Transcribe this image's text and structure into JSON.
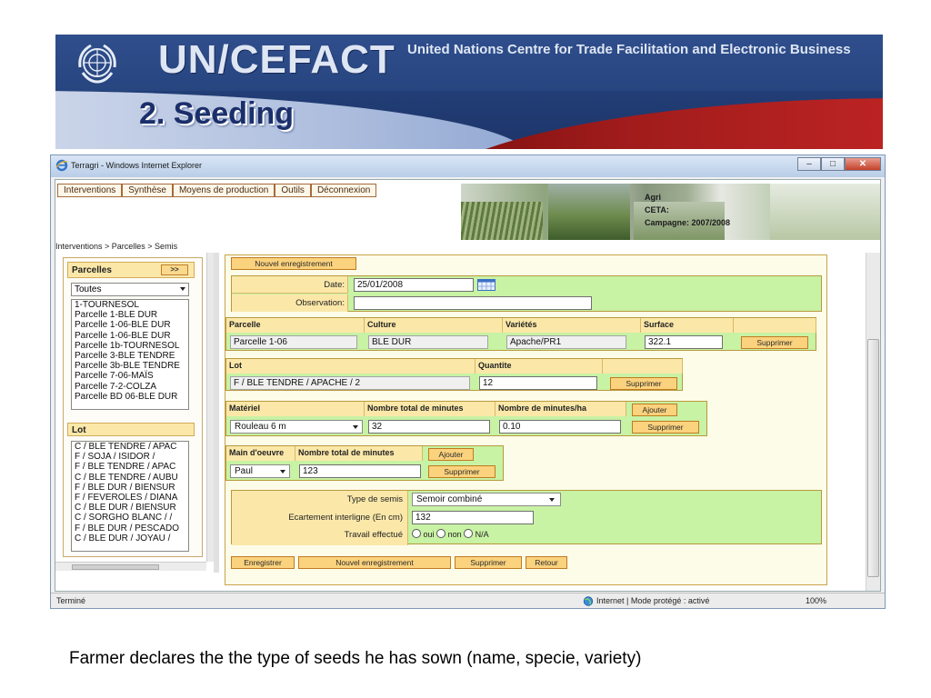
{
  "banner": {
    "title": "UN/CEFACT",
    "subtitle": "United Nations Centre for Trade Facilitation and Electronic Business",
    "heading": "2. Seeding"
  },
  "browser": {
    "window_title": "Terragri - Windows Internet Explorer",
    "status": "Terminé",
    "zone": "Internet | Mode protégé : activé",
    "zoom": "100%"
  },
  "app": {
    "menu": [
      "Interventions",
      "Synthèse",
      "Moyens de production",
      "Outils",
      "Déconnexion"
    ],
    "info": {
      "line1": "Agri",
      "line2": "CETA:",
      "line3": "Campagne: 2007/2008"
    },
    "breadcrumb": "Interventions > Parcelles > Semis"
  },
  "left": {
    "parcelles_label": "Parcelles",
    "expand_label": ">>",
    "filter_value": "Toutes",
    "parcelles": [
      "1-TOURNESOL",
      "Parcelle 1-BLE DUR",
      "Parcelle 1-06-BLE DUR",
      "Parcelle 1-06-BLE DUR",
      "Parcelle 1b-TOURNESOL",
      "Parcelle 3-BLE TENDRE",
      "Parcelle 3b-BLE TENDRE",
      "Parcelle 7-06-MAÏS",
      "Parcelle 7-2-COLZA",
      "Parcelle BD 06-BLE DUR"
    ],
    "lot_label": "Lot",
    "lots": [
      "C / BLE TENDRE / APAC",
      "F / SOJA / ISIDOR /",
      "F / BLE TENDRE / APAC",
      "C / BLE TENDRE / AUBU",
      "F / BLE DUR / BIENSUR",
      "F / FEVEROLES / DIANA",
      "C / BLE DUR / BIENSUR",
      "C / SORGHO BLANC / /",
      "F / BLE DUR / PESCADO",
      "C / BLE DUR / JOYAU /"
    ]
  },
  "form": {
    "new_record_top": "Nouvel enregistrement",
    "date_label": "Date:",
    "date_value": "25/01/2008",
    "observation_label": "Observation:",
    "observation_value": "",
    "parcelle_table": {
      "headers": [
        "Parcelle",
        "Culture",
        "Variétés",
        "Surface"
      ],
      "values": [
        "Parcelle 1-06",
        "BLE DUR",
        "Apache/PR1",
        "322.1"
      ],
      "delete": "Supprimer"
    },
    "lot_table": {
      "headers": [
        "Lot",
        "Quantite"
      ],
      "values": [
        "F / BLE TENDRE / APACHE / 2",
        "12"
      ],
      "delete": "Supprimer"
    },
    "materiel_table": {
      "headers": [
        "Matériel",
        "Nombre total de minutes",
        "Nombre de minutes/ha"
      ],
      "values": [
        "Rouleau 6 m",
        "32",
        "0.10"
      ],
      "add": "Ajouter",
      "delete": "Supprimer"
    },
    "main_oeuvre_table": {
      "headers": [
        "Main d'oeuvre",
        "Nombre total de minutes"
      ],
      "values": [
        "Paul",
        "123"
      ],
      "add": "Ajouter",
      "delete": "Supprimer"
    },
    "semis": {
      "type_label": "Type de semis",
      "type_value": "Semoir combiné",
      "ecartement_label": "Ecartement interligne (En cm)",
      "ecartement_value": "132",
      "travail_label": "Travail effectué",
      "options": [
        "oui",
        "non",
        "N/A"
      ]
    },
    "actions": [
      "Enregistrer",
      "Nouvel enregistrement",
      "Supprimer",
      "Retour"
    ]
  },
  "caption": "Farmer declares the the type of seeds  he has sown (name, specie, variety)"
}
